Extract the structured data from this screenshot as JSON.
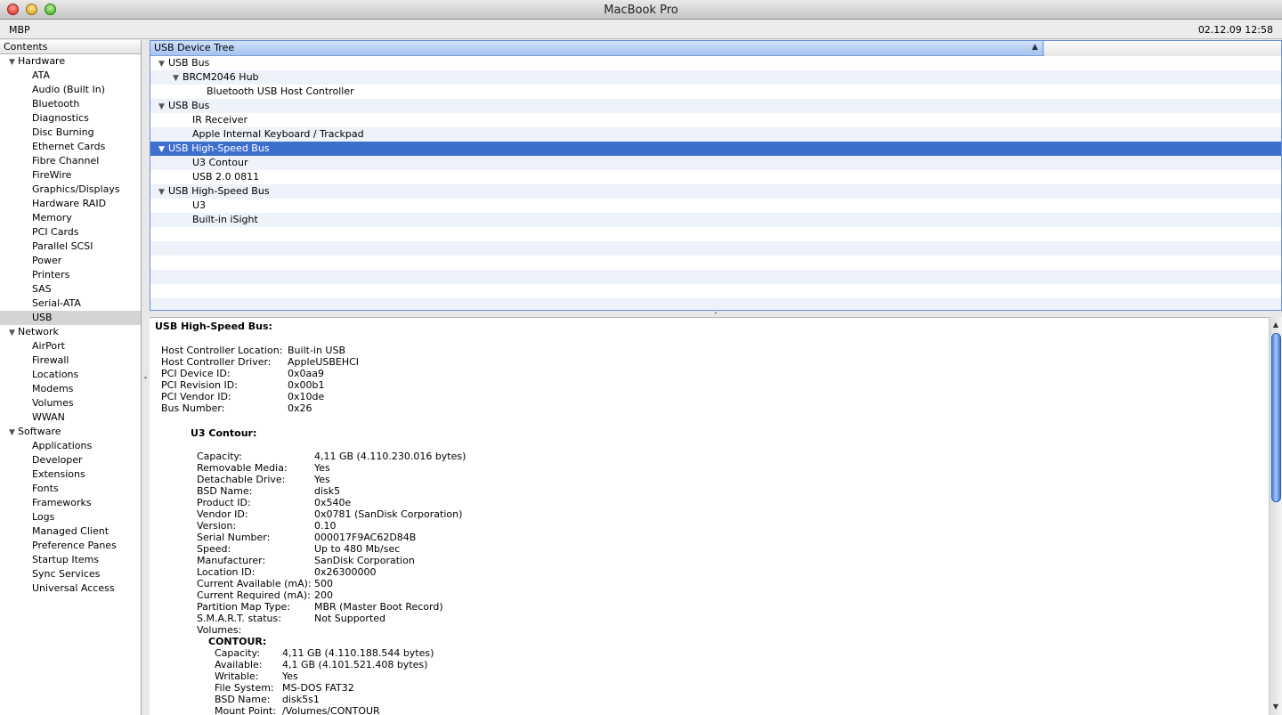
{
  "window": {
    "title": "MacBook Pro"
  },
  "infobar": {
    "machine": "MBP",
    "datetime": "02.12.09 12:58"
  },
  "sidebar": {
    "header": "Contents",
    "items": [
      {
        "label": "Hardware",
        "kind": "cat"
      },
      {
        "label": "ATA",
        "kind": "sub"
      },
      {
        "label": "Audio (Built In)",
        "kind": "sub"
      },
      {
        "label": "Bluetooth",
        "kind": "sub"
      },
      {
        "label": "Diagnostics",
        "kind": "sub"
      },
      {
        "label": "Disc Burning",
        "kind": "sub"
      },
      {
        "label": "Ethernet Cards",
        "kind": "sub"
      },
      {
        "label": "Fibre Channel",
        "kind": "sub"
      },
      {
        "label": "FireWire",
        "kind": "sub"
      },
      {
        "label": "Graphics/Displays",
        "kind": "sub"
      },
      {
        "label": "Hardware RAID",
        "kind": "sub"
      },
      {
        "label": "Memory",
        "kind": "sub"
      },
      {
        "label": "PCI Cards",
        "kind": "sub"
      },
      {
        "label": "Parallel SCSI",
        "kind": "sub"
      },
      {
        "label": "Power",
        "kind": "sub"
      },
      {
        "label": "Printers",
        "kind": "sub"
      },
      {
        "label": "SAS",
        "kind": "sub"
      },
      {
        "label": "Serial-ATA",
        "kind": "sub"
      },
      {
        "label": "USB",
        "kind": "sub",
        "selected": true
      },
      {
        "label": "Network",
        "kind": "cat"
      },
      {
        "label": "AirPort",
        "kind": "sub"
      },
      {
        "label": "Firewall",
        "kind": "sub"
      },
      {
        "label": "Locations",
        "kind": "sub"
      },
      {
        "label": "Modems",
        "kind": "sub"
      },
      {
        "label": "Volumes",
        "kind": "sub"
      },
      {
        "label": "WWAN",
        "kind": "sub"
      },
      {
        "label": "Software",
        "kind": "cat"
      },
      {
        "label": "Applications",
        "kind": "sub"
      },
      {
        "label": "Developer",
        "kind": "sub"
      },
      {
        "label": "Extensions",
        "kind": "sub"
      },
      {
        "label": "Fonts",
        "kind": "sub"
      },
      {
        "label": "Frameworks",
        "kind": "sub"
      },
      {
        "label": "Logs",
        "kind": "sub"
      },
      {
        "label": "Managed Client",
        "kind": "sub"
      },
      {
        "label": "Preference Panes",
        "kind": "sub"
      },
      {
        "label": "Startup Items",
        "kind": "sub"
      },
      {
        "label": "Sync Services",
        "kind": "sub"
      },
      {
        "label": "Universal Access",
        "kind": "sub"
      }
    ]
  },
  "tree": {
    "column_header": "USB Device Tree",
    "rows": [
      {
        "label": "USB Bus",
        "level": "lvl0",
        "expandable": true
      },
      {
        "label": "BRCM2046 Hub",
        "level": "lvl1",
        "expandable": true
      },
      {
        "label": "Bluetooth USB Host Controller",
        "level": "lvl2",
        "expandable": false
      },
      {
        "label": "USB Bus",
        "level": "lvl0",
        "expandable": true
      },
      {
        "label": "IR Receiver",
        "level": "lvl1-leaf",
        "expandable": false
      },
      {
        "label": "Apple Internal Keyboard / Trackpad",
        "level": "lvl1-leaf",
        "expandable": false
      },
      {
        "label": "USB High-Speed Bus",
        "level": "lvl0",
        "expandable": true,
        "selected": true
      },
      {
        "label": "U3 Contour",
        "level": "lvl1-leaf",
        "expandable": false
      },
      {
        "label": "USB 2.0 0811",
        "level": "lvl1-leaf",
        "expandable": false
      },
      {
        "label": "USB High-Speed Bus",
        "level": "lvl0",
        "expandable": true
      },
      {
        "label": "U3",
        "level": "lvl1-leaf",
        "expandable": false
      },
      {
        "label": "Built-in iSight",
        "level": "lvl1-leaf",
        "expandable": false
      },
      {
        "label": "",
        "level": "lvl0",
        "expandable": false
      },
      {
        "label": "",
        "level": "lvl0",
        "expandable": false
      },
      {
        "label": "",
        "level": "lvl0",
        "expandable": false
      },
      {
        "label": "",
        "level": "lvl0",
        "expandable": false
      },
      {
        "label": "",
        "level": "lvl0",
        "expandable": false
      },
      {
        "label": "",
        "level": "lvl0",
        "expandable": false
      }
    ]
  },
  "detail": {
    "title": "USB High-Speed Bus:",
    "bus": [
      {
        "k": "Host Controller Location:",
        "v": "Built-in USB"
      },
      {
        "k": "Host Controller Driver:",
        "v": "AppleUSBEHCI"
      },
      {
        "k": "PCI Device ID:",
        "v": "0x0aa9"
      },
      {
        "k": "PCI Revision ID:",
        "v": "0x00b1"
      },
      {
        "k": "PCI Vendor ID:",
        "v": "0x10de"
      },
      {
        "k": "Bus Number:",
        "v": "0x26"
      }
    ],
    "device_title": "U3 Contour:",
    "device": [
      {
        "k": "Capacity:",
        "v": "4,11 GB (4.110.230.016 bytes)"
      },
      {
        "k": "Removable Media:",
        "v": "Yes"
      },
      {
        "k": "Detachable Drive:",
        "v": "Yes"
      },
      {
        "k": "BSD Name:",
        "v": "disk5"
      },
      {
        "k": "Product ID:",
        "v": "0x540e"
      },
      {
        "k": "Vendor ID:",
        "v": "0x0781  (SanDisk Corporation)"
      },
      {
        "k": "Version:",
        "v": " 0.10"
      },
      {
        "k": "Serial Number:",
        "v": "000017F9AC62D84B"
      },
      {
        "k": "Speed:",
        "v": "Up to 480 Mb/sec"
      },
      {
        "k": "Manufacturer:",
        "v": "SanDisk Corporation"
      },
      {
        "k": "Location ID:",
        "v": "0x26300000"
      },
      {
        "k": "Current Available (mA):",
        "v": "500"
      },
      {
        "k": "Current Required (mA):",
        "v": "200"
      },
      {
        "k": "Partition Map Type:",
        "v": "MBR (Master Boot Record)"
      },
      {
        "k": "S.M.A.R.T. status:",
        "v": "Not Supported"
      },
      {
        "k": "Volumes:",
        "v": ""
      }
    ],
    "volume_title": "CONTOUR:",
    "volume": [
      {
        "k": "Capacity:",
        "v": "4,11 GB (4.110.188.544 bytes)"
      },
      {
        "k": "Available:",
        "v": "4,1 GB (4.101.521.408 bytes)"
      },
      {
        "k": "Writable:",
        "v": "Yes"
      },
      {
        "k": "File System:",
        "v": "MS-DOS FAT32"
      },
      {
        "k": "BSD Name:",
        "v": "disk5s1"
      },
      {
        "k": "Mount Point:",
        "v": "/Volumes/CONTOUR"
      }
    ]
  }
}
